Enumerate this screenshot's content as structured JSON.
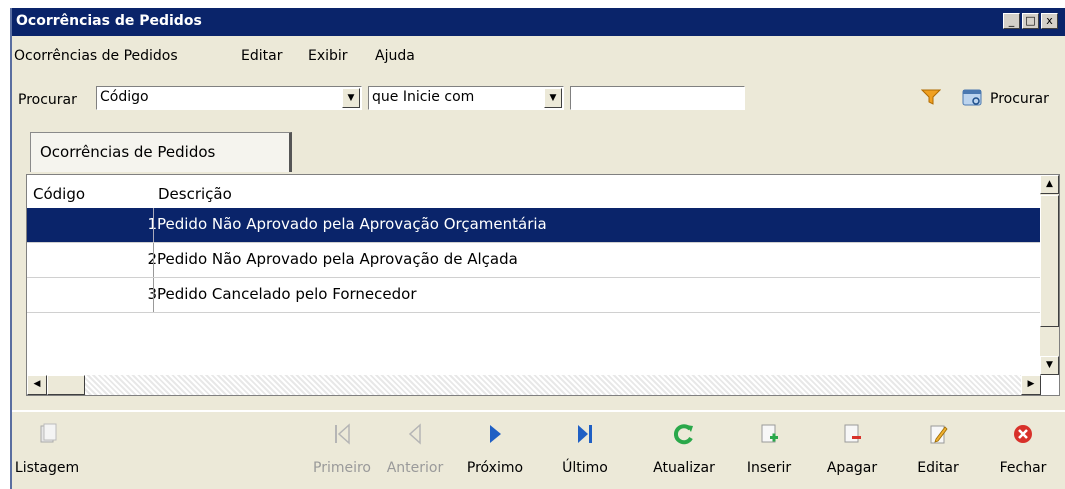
{
  "window": {
    "title": "Ocorrências de Pedidos",
    "controls": [
      "_",
      "□",
      "x"
    ]
  },
  "menu": [
    {
      "label": "Ocorrências de Pedidos"
    },
    {
      "label": "Editar"
    },
    {
      "label": "Exibir"
    },
    {
      "label": "Ajuda"
    }
  ],
  "search": {
    "label": "Procurar",
    "field_value": "Código",
    "condition_value": "que Inicie com",
    "text_value": "",
    "button_label": "Procurar"
  },
  "tab": {
    "label": "Ocorrências de Pedidos"
  },
  "grid": {
    "columns": [
      "Código",
      "Descrição"
    ],
    "rows": [
      {
        "code": "1",
        "desc": "Pedido Não Aprovado pela Aprovação Orçamentária",
        "selected": true
      },
      {
        "code": "2",
        "desc": "Pedido Não Aprovado pela Aprovação de Alçada",
        "selected": false
      },
      {
        "code": "3",
        "desc": "Pedido Cancelado pelo Fornecedor",
        "selected": false
      }
    ]
  },
  "toolbar": {
    "listagem": "Listagem",
    "primeiro": "Primeiro",
    "anterior": "Anterior",
    "proximo": "Próximo",
    "ultimo": "Último",
    "atualizar": "Atualizar",
    "inserir": "Inserir",
    "apagar": "Apagar",
    "editar": "Editar",
    "fechar": "Fechar"
  },
  "colors": {
    "titlebar": "#0a246a",
    "selection": "#0a246a",
    "nav_blue": "#1f5fc4",
    "refresh_green": "#2aa84a",
    "close_red": "#d8312a",
    "filter_orange": "#f0a020"
  }
}
